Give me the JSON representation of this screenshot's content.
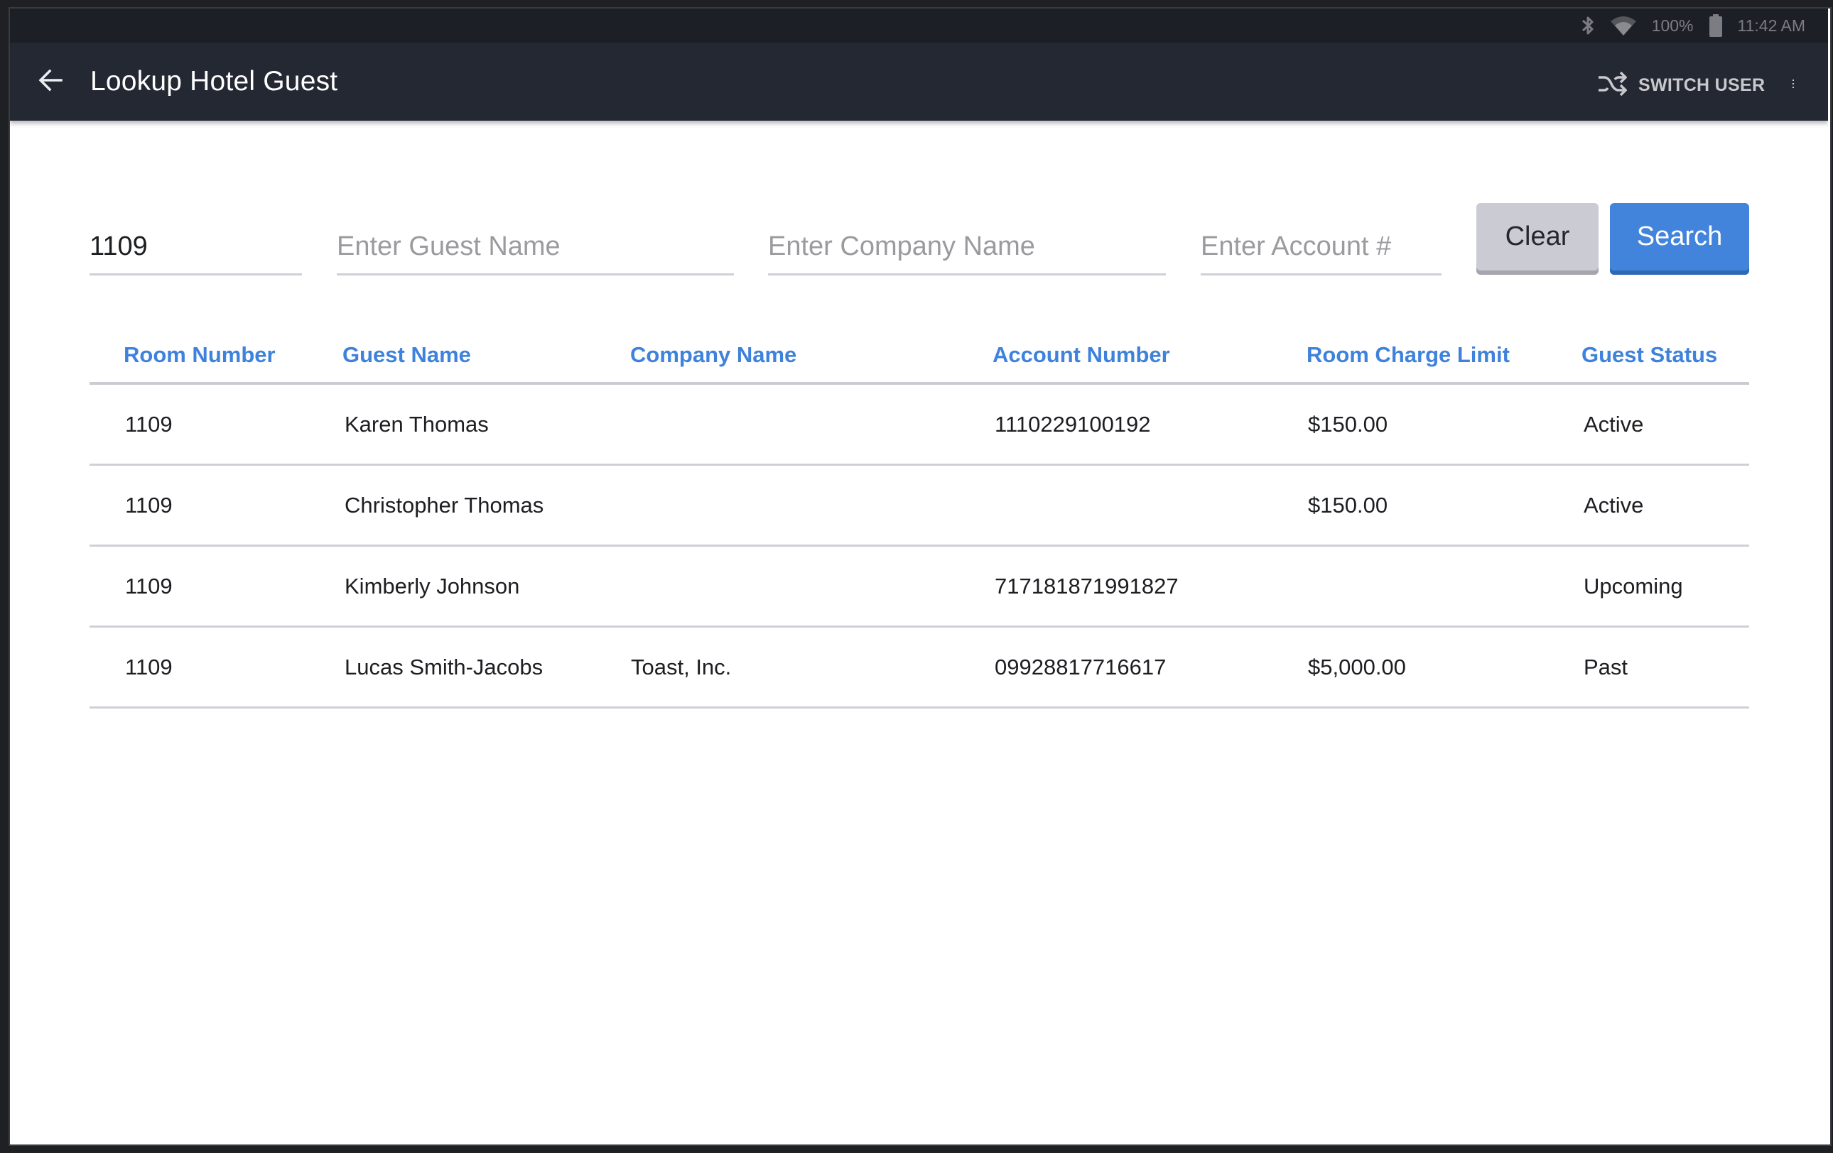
{
  "status_bar": {
    "icons": [
      "bluetooth-icon",
      "wifi-icon",
      "battery-icon"
    ],
    "battery": "100%",
    "time": "11:42 AM"
  },
  "app_bar": {
    "back_icon": "arrow-left-icon",
    "title": "Lookup Hotel Guest",
    "switch_user_icon": "shuffle-icon",
    "switch_user_label": "SWITCH USER",
    "more_icon": "more-vert-icon"
  },
  "search": {
    "room": {
      "value": "1109",
      "placeholder": ""
    },
    "guest_name": {
      "value": "",
      "placeholder": "Enter Guest Name"
    },
    "company_name": {
      "value": "",
      "placeholder": "Enter Company Name"
    },
    "account": {
      "value": "",
      "placeholder": "Enter Account #"
    },
    "clear_label": "Clear",
    "search_label": "Search"
  },
  "colors": {
    "accent": "#4284db",
    "header_text": "#3f82dc",
    "app_bar": "#242833",
    "status_bar": "#1c1f26"
  },
  "table": {
    "columns": [
      "Room Number",
      "Guest Name",
      "Company Name",
      "Account Number",
      "Room Charge Limit",
      "Guest Status"
    ],
    "rows": [
      [
        "1109",
        "Karen Thomas",
        "",
        "1110229100192",
        "$150.00",
        "Active"
      ],
      [
        "1109",
        "Christopher Thomas",
        "",
        "",
        "$150.00",
        "Active"
      ],
      [
        "1109",
        "Kimberly Johnson",
        "",
        "717181871991827",
        "",
        "Upcoming"
      ],
      [
        "1109",
        "Lucas Smith-Jacobs",
        "Toast, Inc.",
        "09928817716617",
        "$5,000.00",
        "Past"
      ]
    ]
  }
}
